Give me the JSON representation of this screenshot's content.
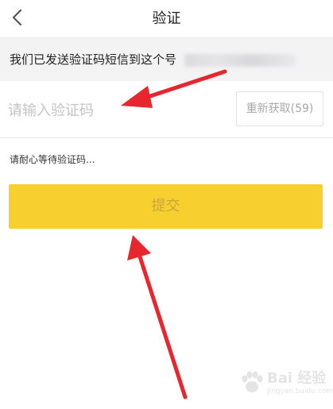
{
  "header": {
    "title": "验证",
    "back_icon": "chevron-left-icon"
  },
  "notice": {
    "text": "我们已发送验证码短信到这个号"
  },
  "code_form": {
    "placeholder": "请输入验证码",
    "value": "",
    "resend_label": "重新获取(59)"
  },
  "wait_hint": "请耐心等待验证码...",
  "submit_label": "提交",
  "watermark": {
    "text": "Bai 经验",
    "sub": "jingyan.baidu.com",
    "icon": "paw-icon"
  },
  "colors": {
    "submit_bg": "#f7d030",
    "submit_text": "#c9a63a",
    "banner_bg": "#f3f3f4",
    "arrow": "#e8262e"
  }
}
